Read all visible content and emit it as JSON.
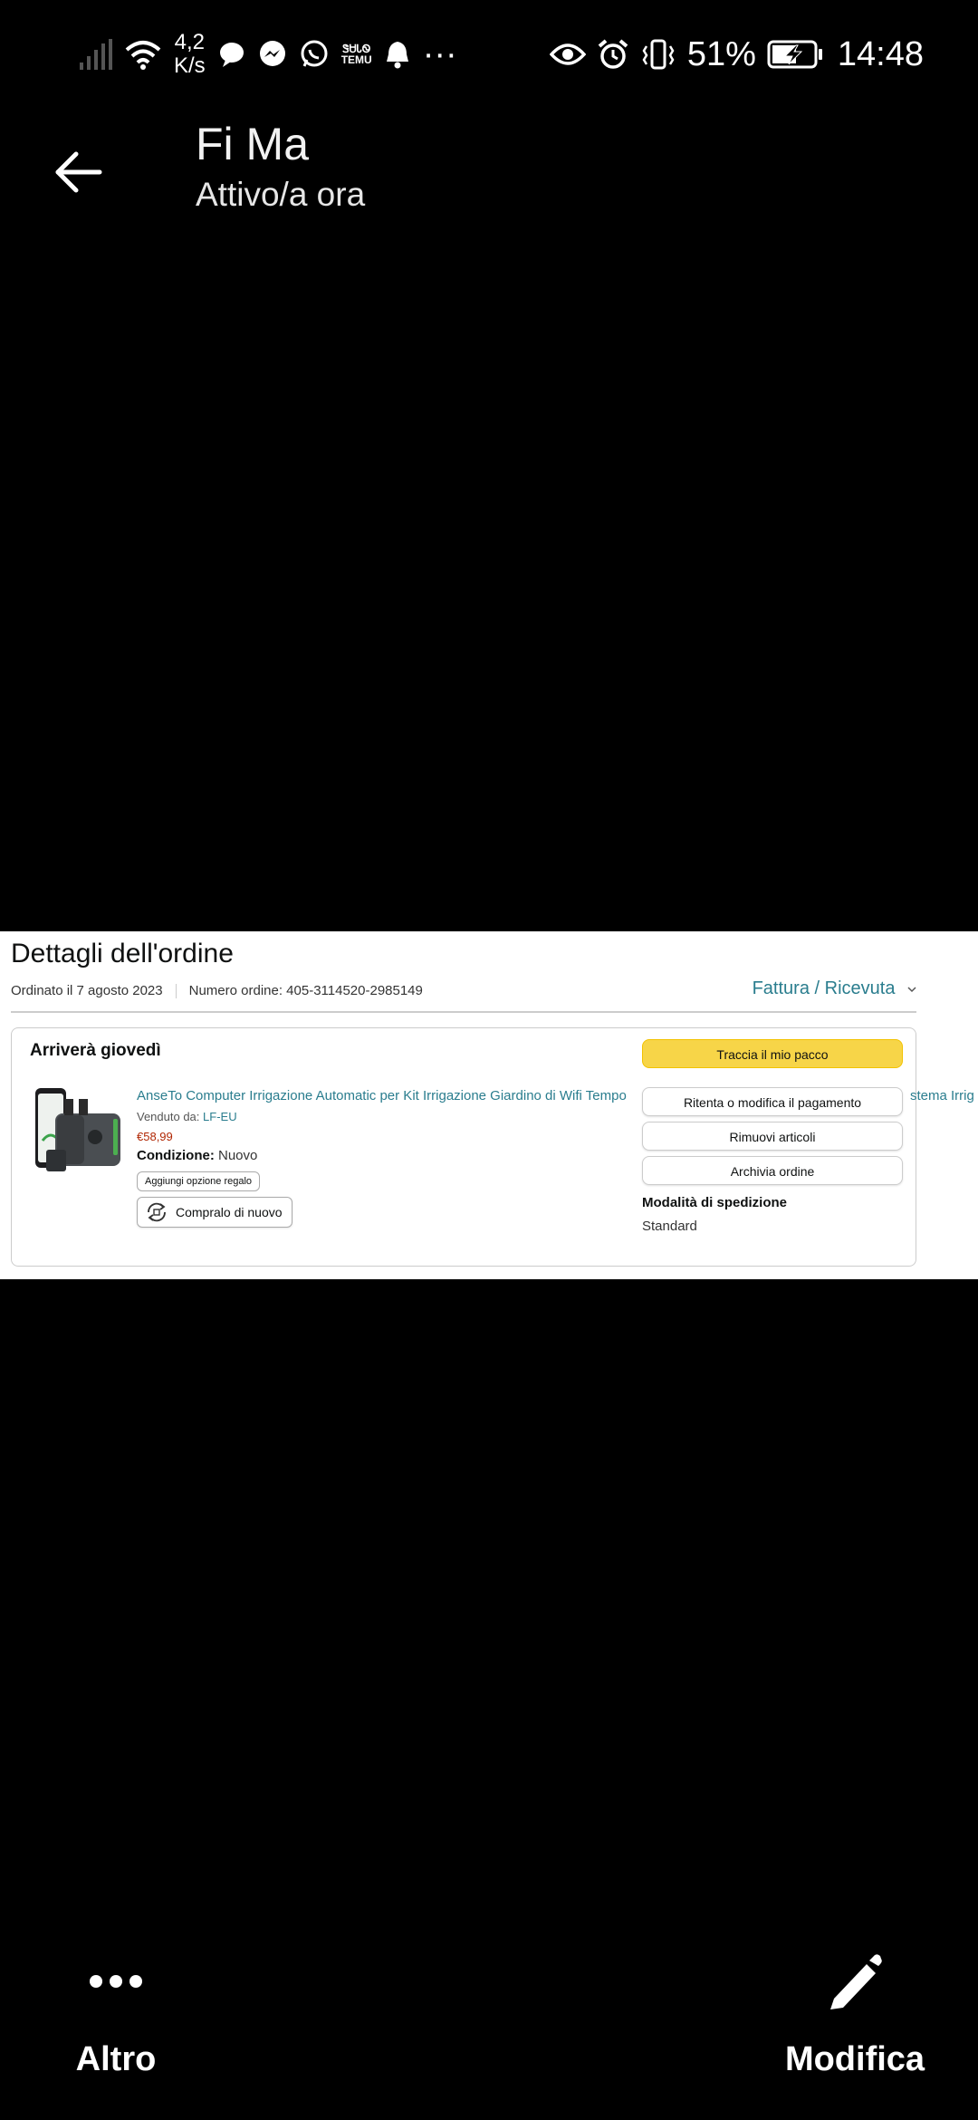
{
  "status_bar": {
    "speed_value": "4,2",
    "speed_unit": "K/s",
    "temu_label_top": "ᏕᏌᏓᏫ",
    "temu_label_bottom": "TEMU",
    "more_dots": "···",
    "battery_percent": "51%",
    "time": "14:48"
  },
  "header": {
    "contact_name": "Fi Ma",
    "contact_status": "Attivo/a ora"
  },
  "order": {
    "title": "Dettagli dell'ordine",
    "ordered_date": "Ordinato il 7 agosto 2023",
    "order_number": "Numero ordine: 405-3114520-2985149",
    "invoice_link": "Fattura / Ricevuta",
    "arrival": "Arriverà giovedì",
    "product_title": "AnseTo Computer Irrigazione Automatic per Kit Irrigazione Giardino di Wifi Tempo",
    "product_title_tail": "stema Irrig",
    "seller_prefix": "Venduto da:",
    "seller_name": "LF-EU",
    "price": "€58,99",
    "condition_label": "Condizione:",
    "condition_value": "Nuovo",
    "gift_option": "Aggiungi opzione regalo",
    "buy_again": "Compralo di nuovo",
    "track_button": "Traccia il mio pacco",
    "retry_payment_button": "Ritenta o modifica il pagamento",
    "remove_items_button": "Rimuovi articoli",
    "archive_button": "Archivia ordine",
    "shipping_heading": "Modalità di spedizione",
    "shipping_value": "Standard"
  },
  "bottom_bar": {
    "more_label": "Altro",
    "edit_label": "Modifica"
  },
  "colors": {
    "background": "#000000",
    "link_teal": "#2a7d8e",
    "price_red": "#b12704",
    "button_yellow": "#f7d548"
  }
}
